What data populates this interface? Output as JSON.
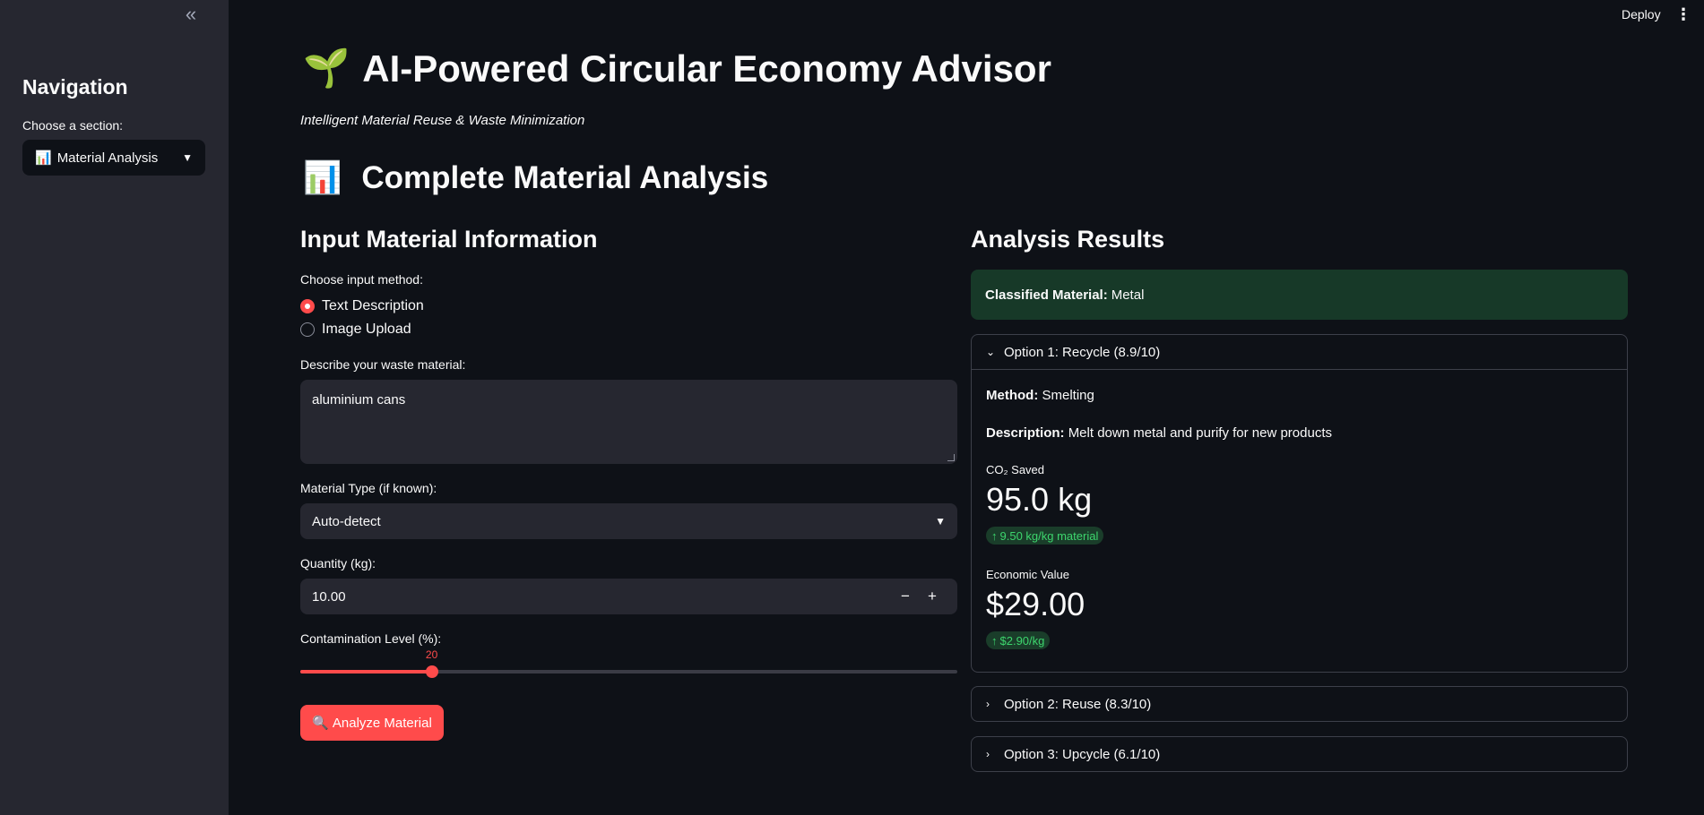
{
  "sidebar": {
    "collapse_icon": "«",
    "title": "Navigation",
    "select_label": "Choose a section:",
    "select_emoji": "📊",
    "select_value": "Material Analysis"
  },
  "header": {
    "deploy": "Deploy",
    "menu_icon": "⋮"
  },
  "main": {
    "title_emoji": "🌱",
    "title": "AI-Powered Circular Economy Advisor",
    "subtitle": "Intelligent Material Reuse & Waste Minimization",
    "section_emoji": "📊",
    "section_title": "Complete Material Analysis"
  },
  "input": {
    "heading": "Input Material Information",
    "method_label": "Choose input method:",
    "methods": [
      "Text Description",
      "Image Upload"
    ],
    "selected_method": "Text Description",
    "describe_label": "Describe your waste material:",
    "describe_value": "aluminium cans",
    "type_label": "Material Type (if known):",
    "type_value": "Auto-detect",
    "quantity_label": "Quantity (kg):",
    "quantity_value": "10.00",
    "contamination_label": "Contamination Level (%):",
    "contamination_value": 20,
    "contamination_value_text": "20",
    "analyze_emoji": "🔍",
    "analyze_label": "Analyze Material"
  },
  "results": {
    "heading": "Analysis Results",
    "classified_label": "Classified Material:",
    "classified_value": "Metal",
    "options": [
      {
        "label": "Option 1: Recycle (8.9/10)",
        "expanded": true,
        "method_label": "Method:",
        "method": "Smelting",
        "description_label": "Description:",
        "description": "Melt down metal and purify for new products",
        "co2_label": "CO₂ Saved",
        "co2_value": "95.0 kg",
        "co2_delta": "9.50 kg/kg material",
        "econ_label": "Economic Value",
        "econ_value": "$29.00",
        "econ_delta": "$2.90/kg"
      },
      {
        "label": "Option 2: Reuse (8.3/10)",
        "expanded": false
      },
      {
        "label": "Option 3: Upcycle (6.1/10)",
        "expanded": false
      }
    ]
  },
  "colors": {
    "accent": "#ff4b4b",
    "success_bg": "#173928",
    "delta_green": "#3dd56d"
  }
}
